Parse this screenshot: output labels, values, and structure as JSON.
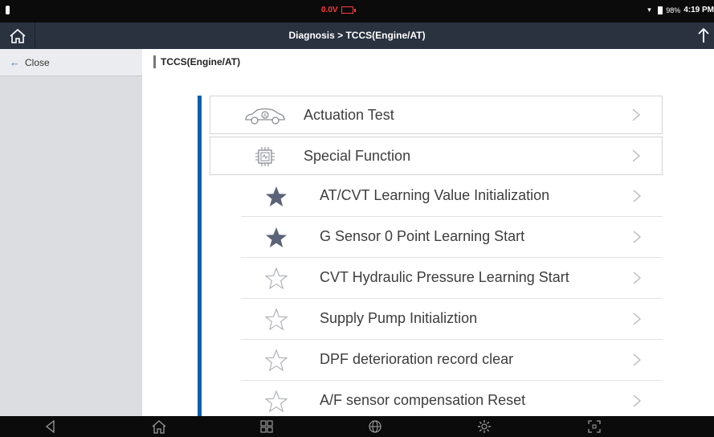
{
  "statusbar": {
    "voltage": "0.0V",
    "battery_percent": "98%",
    "time": "4:19 PM"
  },
  "titlebar": {
    "title": "Diagnosis > TCCS(Engine/AT)"
  },
  "sidebar": {
    "close_label": "Close"
  },
  "main": {
    "breadcrumb": "TCCS(Engine/AT)",
    "groups": [
      {
        "label": "Actuation Test",
        "icon": "car-icon"
      },
      {
        "label": "Special Function",
        "icon": "chip-icon"
      }
    ],
    "functions": [
      {
        "label": "AT/CVT Learning Value Initialization",
        "favorite": true
      },
      {
        "label": "G Sensor 0 Point Learning Start",
        "favorite": true
      },
      {
        "label": "CVT Hydraulic Pressure Learning Start",
        "favorite": false
      },
      {
        "label": "Supply Pump Initializtion",
        "favorite": false
      },
      {
        "label": "DPF deterioration record clear",
        "favorite": false
      },
      {
        "label": "A/F sensor compensation Reset",
        "favorite": false
      }
    ]
  },
  "colors": {
    "accent": "#0f5ea8",
    "titlebar": "#2a3240",
    "star_filled": "#5a6378"
  },
  "navbar": {
    "icons": [
      "back-icon",
      "home-icon",
      "recents-icon",
      "browser-icon",
      "settings-icon",
      "screenshot-icon"
    ]
  }
}
